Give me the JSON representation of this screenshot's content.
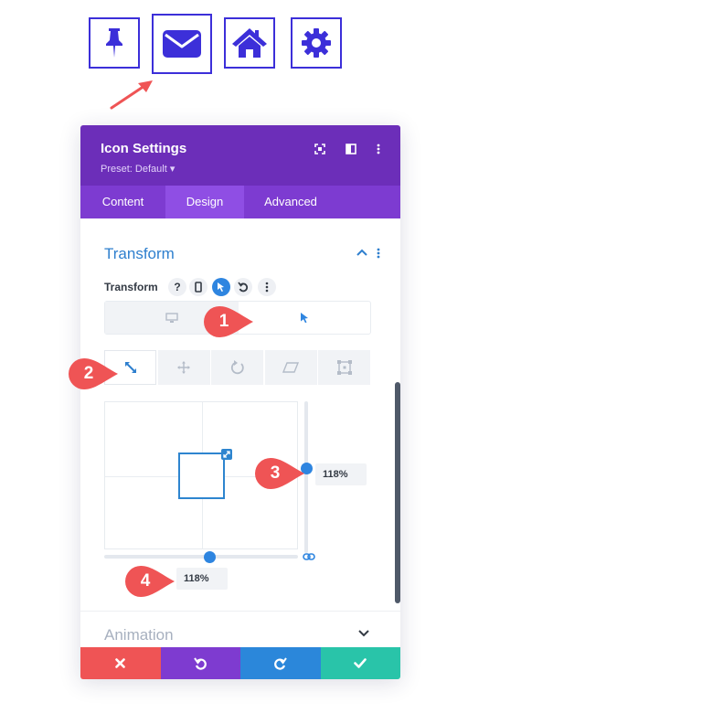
{
  "top_icons": [
    {
      "name": "thumbtack-icon"
    },
    {
      "name": "envelope-icon",
      "selected": true
    },
    {
      "name": "home-icon"
    },
    {
      "name": "gear-icon"
    }
  ],
  "colors": {
    "icon_accent": "#3c2fd9",
    "header_bg": "#6c2eb9",
    "tabs_bg": "#7d3bd1",
    "active_tab_bg": "#8f4ee4",
    "section_title": "#2e7fce",
    "slider_accent": "#2e85e0",
    "callout": "#ef5455",
    "arrow": "#ef5455",
    "cancel": "#ef5455",
    "undo": "#7e3bd0",
    "redo": "#2b87da",
    "save": "#29c4a9"
  },
  "panel": {
    "title": "Icon Settings",
    "preset": "Preset: Default ▾",
    "header_icons": [
      "fullscreen-icon",
      "split-view-icon",
      "more-icon"
    ],
    "tabs": [
      {
        "label": "Content",
        "active": false
      },
      {
        "label": "Design",
        "active": true
      },
      {
        "label": "Advanced",
        "active": false
      }
    ],
    "section": {
      "title": "Transform",
      "option_label": "Transform",
      "option_icons": [
        "help-icon",
        "mobile-icon",
        "hover-cursor-icon",
        "reset-icon",
        "more-icon"
      ],
      "states": [
        {
          "name": "desktop",
          "icon": "desktop-icon"
        },
        {
          "name": "hover",
          "icon": "cursor-icon",
          "active": true
        }
      ],
      "tools": [
        {
          "name": "scale",
          "icon": "scale-icon",
          "active": true
        },
        {
          "name": "translate",
          "icon": "move-icon"
        },
        {
          "name": "rotate",
          "icon": "rotate-icon"
        },
        {
          "name": "skew",
          "icon": "skew-icon"
        },
        {
          "name": "origin",
          "icon": "origin-icon"
        }
      ],
      "scale_y": "118%",
      "scale_x": "118%"
    },
    "collapsed_section": "Animation",
    "footer_buttons": [
      "cancel-icon",
      "undo-icon",
      "redo-icon",
      "save-icon"
    ]
  },
  "callouts": [
    "1",
    "2",
    "3",
    "4"
  ]
}
